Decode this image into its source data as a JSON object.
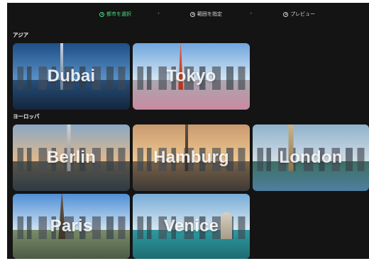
{
  "steps": [
    {
      "label": "都市を選択",
      "icon": "radio-check-icon",
      "active": true
    },
    {
      "label": "範囲を指定",
      "icon": "radio-icon",
      "active": false
    },
    {
      "label": "プレビュー",
      "icon": "plus-circle-icon",
      "active": false
    }
  ],
  "step_separator": "›",
  "sections": [
    {
      "title": "アジア",
      "cities": [
        {
          "name": "Dubai",
          "sky": "#3f7fbf",
          "ground": "#1c3a5c"
        },
        {
          "name": "Tokyo",
          "sky": "#9cc3e6",
          "ground": "#9a9aa4"
        }
      ]
    },
    {
      "title": "ヨーロッパ",
      "cities": [
        {
          "name": "Berlin",
          "sky": "#c7a27a",
          "ground": "#4a4a44"
        },
        {
          "name": "Hamburg",
          "sky": "#e0b07a",
          "ground": "#6e5a44"
        },
        {
          "name": "London",
          "sky": "#b3c8d8",
          "ground": "#3f6a5e"
        },
        {
          "name": "Paris",
          "sky": "#7fb0e0",
          "ground": "#5c7a5a"
        },
        {
          "name": "Venice",
          "sky": "#9cc4e0",
          "ground": "#2e8a8e"
        }
      ]
    }
  ],
  "colors": {
    "background": "#141414",
    "accent": "#4ade80"
  }
}
